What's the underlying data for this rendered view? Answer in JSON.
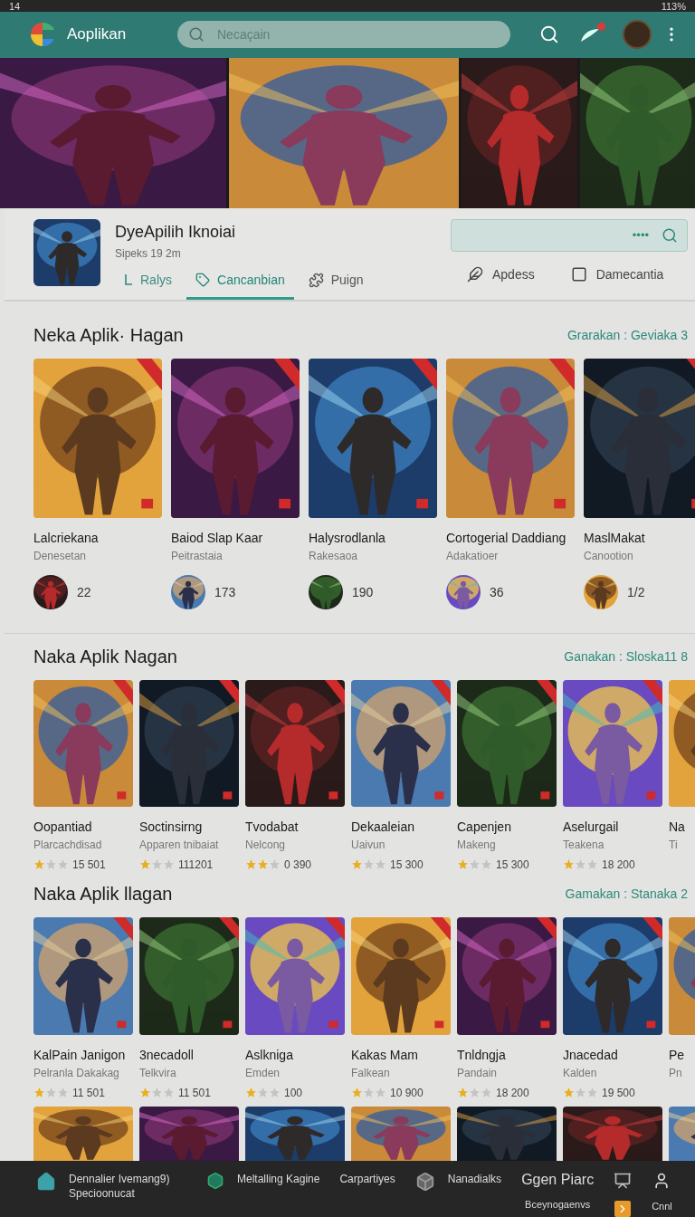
{
  "status_bar": {
    "time": "14",
    "battery": "113%"
  },
  "app_bar": {
    "title": "Aoplikan",
    "search": {
      "placeholder": "Necaçain"
    },
    "notification_badge": true
  },
  "app_detail": {
    "title": "DyeApilih Iknoiai",
    "subtitle": "Sipeks 19 2m",
    "tabs": [
      {
        "label": "Ralys",
        "selected": false
      },
      {
        "label": "Cancanbian",
        "selected": true
      },
      {
        "label": "Puign",
        "selected": false
      }
    ],
    "search": {
      "value": "••••"
    },
    "actions": [
      {
        "label": "Apdess"
      },
      {
        "label": "Damecantia"
      }
    ]
  },
  "sections": [
    {
      "kind": "large",
      "title": "Neka Aplik· Hagan",
      "link": "Grarakan : Geviaka 3",
      "apps": [
        {
          "name": "Lalcriekana",
          "developer": "Denesetan",
          "count": "22"
        },
        {
          "name": "Baiod Slap Kaar",
          "developer": "Peitrastaia",
          "count": "173"
        },
        {
          "name": "Halysrodlanla",
          "developer": "Rakesaoa",
          "count": "190"
        },
        {
          "name": "Cortogerial Daddiang",
          "developer": "Adakatioer",
          "count": "36"
        },
        {
          "name": "MaslMakat",
          "developer": "Canootion",
          "count": "1/2"
        }
      ]
    },
    {
      "kind": "rated",
      "title": "Naka Aplik Nagan",
      "link": "Ganakan : Sloska11 8",
      "apps": [
        {
          "name": "Oopantiad",
          "developer": "Plarcachdisad",
          "stars": 1,
          "count": "15 501"
        },
        {
          "name": "Soctinsirng",
          "developer": "Apparen tnibaiat",
          "stars": 1,
          "count": "111201"
        },
        {
          "name": "Tvodabat",
          "developer": "Nelcong",
          "stars": 2,
          "count": "0 390"
        },
        {
          "name": "Dekaaleian",
          "developer": "Uaivun",
          "stars": 1,
          "count": "15 300"
        },
        {
          "name": "Capenjen",
          "developer": "Makeng",
          "stars": 1,
          "count": "15 300"
        },
        {
          "name": "Aselurgail",
          "developer": "Teakena",
          "stars": 1,
          "count": "18 200"
        },
        {
          "name": "Na",
          "developer": "Ti"
        }
      ]
    },
    {
      "kind": "rated",
      "title": "Naka Aplik llagan",
      "link": "Gamakan : Stanaka 2",
      "apps": [
        {
          "name": "KalPain Janigon",
          "developer": "Pelranla Dakakag",
          "stars": 1,
          "count": "11 501"
        },
        {
          "name": "3necadoll",
          "developer": "Telkvira",
          "stars": 1,
          "count": "11 501"
        },
        {
          "name": "Aslkniga",
          "developer": "Emden",
          "stars": 1,
          "count": "100"
        },
        {
          "name": "Kakas Mam",
          "developer": "Falkean",
          "stars": 1,
          "count": "10 900"
        },
        {
          "name": "Tnldngja",
          "developer": "Pandain",
          "stars": 1,
          "count": "18 200"
        },
        {
          "name": "Jnacedad",
          "developer": "Kalden",
          "stars": 1,
          "count": "19 500"
        },
        {
          "name": "Pe",
          "developer": "Pn"
        }
      ]
    },
    {
      "kind": "peek"
    }
  ],
  "bottom_nav": [
    {
      "kind": "labeled",
      "label": "Dennalier Ivemang9) Specioonucat"
    },
    {
      "kind": "labeled",
      "label": "Meltalling Kagine"
    },
    {
      "kind": "labeled",
      "label": "Carpartiyes"
    },
    {
      "kind": "labeled",
      "label": "Nanadialks"
    },
    {
      "kind": "stacked",
      "label": "Ggen Piarc",
      "caption": "Bceynogaenvs"
    },
    {
      "kind": "shortcut"
    },
    {
      "kind": "profile",
      "label": "Cnnl"
    }
  ]
}
